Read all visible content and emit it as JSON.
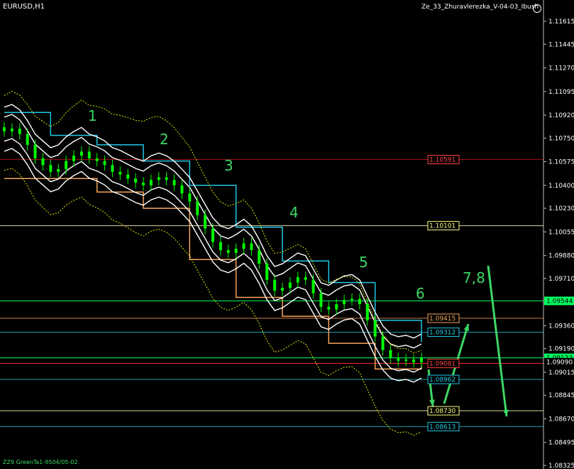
{
  "window": {
    "symbol_label": "EURUSD,H1",
    "indicator_label": "Ze_33_Zhuravlerezka_V-04-03_Ibush",
    "smiley_icon": "smiley-icon",
    "footer_label": "ZZ9 GreenTa1-9504/05-02"
  },
  "colors": {
    "background": "#000000",
    "axis": "#c0c0c0",
    "candle": "#00ff00",
    "band": "#ffffff",
    "step_cyan": "#1ec8e6",
    "step_orange": "#f5a35a",
    "envelope_yellow": "#e6e600",
    "wave_label": "#3cd764",
    "arrow": "#3cd764"
  },
  "chart_data": {
    "type": "candlestick",
    "symbol": "EURUSD",
    "timeframe": "H1",
    "y_axis": {
      "range": [
        1.08325,
        1.11615
      ],
      "ticks": [
        "1.11615",
        "1.11445",
        "1.11270",
        "1.11095",
        "1.10920",
        "1.10750",
        "1.10575",
        "1.10400",
        "1.10230",
        "1.10055",
        "1.09880",
        "1.09710",
        "1.09535",
        "1.09360",
        "1.09190",
        "1.09015",
        "1.08845",
        "1.08670",
        "1.08495",
        "1.08325"
      ]
    },
    "price_levels": [
      {
        "value": "1.10591",
        "color": "#ff4040",
        "line": "#a01010"
      },
      {
        "value": "1.10101",
        "color": "#ffff80",
        "line": "#d8d8a0"
      },
      {
        "value": "1.09544",
        "color": "#00ff60",
        "line": "#00ff60",
        "right_tag": true
      },
      {
        "value": "1.09415",
        "color": "#f5a35a",
        "line": "#c88040"
      },
      {
        "value": "1.09312",
        "color": "#1ec8e6",
        "line": "#1e9bb0"
      },
      {
        "value": "1.09122",
        "color": "#00ff60",
        "line": "#00ff60",
        "right_tag": true
      },
      {
        "value": "1.09090",
        "color": "#ffffff",
        "line": null,
        "right_tag": true
      },
      {
        "value": "1.09081",
        "color": "#ff4040",
        "line": "#ff3030"
      },
      {
        "value": "1.08962",
        "color": "#1ec8e6",
        "line": "#1e9bb0"
      },
      {
        "value": "1.08730",
        "color": "#ffff80",
        "line": "#d8d8a0"
      },
      {
        "value": "1.08613",
        "color": "#1ec8e6",
        "line": "#1e9bb0"
      }
    ],
    "wave_labels": [
      "1",
      "2",
      "3",
      "4",
      "5",
      "6",
      "7,8"
    ],
    "close_series": [
      1.108,
      1.1082,
      1.1078,
      1.107,
      1.106,
      1.1055,
      1.105,
      1.1052,
      1.1058,
      1.1062,
      1.1065,
      1.106,
      1.1058,
      1.1055,
      1.105,
      1.1048,
      1.1045,
      1.1042,
      1.104,
      1.1044,
      1.1046,
      1.1044,
      1.104,
      1.1034,
      1.1028,
      1.1018,
      1.1008,
      1.0998,
      1.0992,
      1.099,
      1.0993,
      1.0997,
      1.0992,
      1.0982,
      1.097,
      1.0962,
      1.0964,
      1.0968,
      1.0972,
      1.097,
      1.096,
      1.095,
      1.0948,
      1.0952,
      1.0955,
      1.0956,
      1.0952,
      1.094,
      1.0928,
      1.0918,
      1.0912,
      1.091,
      1.0911,
      1.0909,
      1.0912
    ]
  }
}
